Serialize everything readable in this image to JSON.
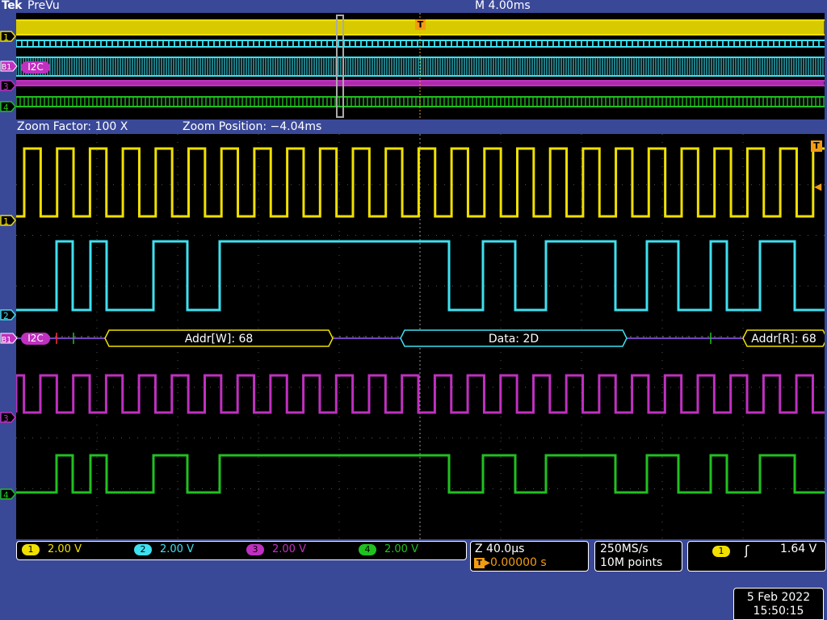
{
  "header": {
    "brand": "Tek",
    "mode": "PreVu",
    "timebase": "M 4.00ms"
  },
  "zoom": {
    "factor": "Zoom Factor: 100 X",
    "position": "Zoom Position: −4.04ms"
  },
  "markers": {
    "ch1": "1",
    "ch2": "2",
    "ch3": "3",
    "ch4": "4",
    "bus": "B1",
    "bus_label": "I2C",
    "trigger": "T"
  },
  "decode": {
    "packets": [
      {
        "label": "Addr[W]: 68",
        "color": "#f0e000"
      },
      {
        "label": "Data: 2D",
        "color": "#3ee0f0"
      },
      {
        "label": "Addr[R]: 68",
        "color": "#f0e000"
      }
    ]
  },
  "channels": [
    {
      "num": "1",
      "scale": "2.00 V",
      "color": "#f0e000"
    },
    {
      "num": "2",
      "scale": "2.00 V",
      "color": "#3ee0f0"
    },
    {
      "num": "3",
      "scale": "2.00 V",
      "color": "#c030c0"
    },
    {
      "num": "4",
      "scale": "2.00 V",
      "color": "#20c020"
    }
  ],
  "horizontal": {
    "zoom_scale": "Z 40.0µs",
    "trigger_pos_icon": "T",
    "trigger_offset": "▸0.00000 s"
  },
  "acquisition": {
    "rate": "250MS/s",
    "points": "10M points"
  },
  "trigger": {
    "source": "1",
    "slope_icon": "rising-edge-icon",
    "slope_glyph": "ʃ",
    "level": "1.64 V"
  },
  "datetime": {
    "date": "5 Feb  2022",
    "time": "15:50:15"
  }
}
